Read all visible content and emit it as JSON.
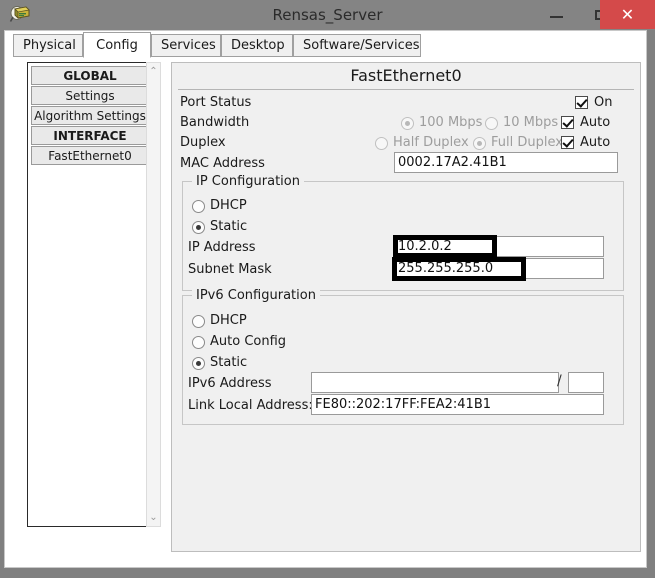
{
  "window": {
    "title": "Rensas_Server",
    "icon": "server-device-icon",
    "controls": {
      "minimize": "–",
      "maximize": "□",
      "close": "✕",
      "close_color": "#d44a4a"
    }
  },
  "tabs": [
    {
      "label": "Physical",
      "active": false
    },
    {
      "label": "Config",
      "active": true
    },
    {
      "label": "Services",
      "active": false
    },
    {
      "label": "Desktop",
      "active": false
    },
    {
      "label": "Software/Services",
      "active": false
    }
  ],
  "sidebar": {
    "items": [
      {
        "label": "GLOBAL",
        "header": true
      },
      {
        "label": "Settings",
        "header": false
      },
      {
        "label": "Algorithm Settings",
        "header": false
      },
      {
        "label": "INTERFACE",
        "header": true
      },
      {
        "label": "FastEthernet0",
        "header": false
      }
    ],
    "scroll_up": "⌃",
    "scroll_down": "⌄"
  },
  "panel": {
    "title": "FastEthernet0",
    "port_status": {
      "label": "Port Status",
      "on_label": "On",
      "on_checked": true
    },
    "bandwidth": {
      "label": "Bandwidth",
      "option_100": "100 Mbps",
      "option_10": "10 Mbps",
      "selected": "100 Mbps",
      "auto_label": "Auto",
      "auto_checked": true,
      "disabled": true
    },
    "duplex": {
      "label": "Duplex",
      "option_half": "Half Duplex",
      "option_full": "Full Duplex",
      "selected": "Full Duplex",
      "auto_label": "Auto",
      "auto_checked": true,
      "disabled": true
    },
    "mac": {
      "label": "MAC Address",
      "value": "0002.17A2.41B1"
    },
    "ip_config": {
      "title": "IP Configuration",
      "dhcp_label": "DHCP",
      "static_label": "Static",
      "selected": "Static",
      "ip_address_label": "IP Address",
      "ip_address_value": "10.2.0.2",
      "subnet_mask_label": "Subnet Mask",
      "subnet_mask_value": "255.255.255.0",
      "highlighted_fields": [
        "ip_address",
        "subnet_mask"
      ],
      "highlight_color": "#000000"
    },
    "ipv6_config": {
      "title": "IPv6 Configuration",
      "dhcp_label": "DHCP",
      "auto_config_label": "Auto Config",
      "static_label": "Static",
      "selected": "Static",
      "ipv6_address_label": "IPv6 Address",
      "ipv6_address_value": "",
      "prefix_separator": "/",
      "prefix_value": "",
      "link_local_label": "Link Local Address:",
      "link_local_value": "FE80::202:17FF:FEA2:41B1"
    }
  }
}
